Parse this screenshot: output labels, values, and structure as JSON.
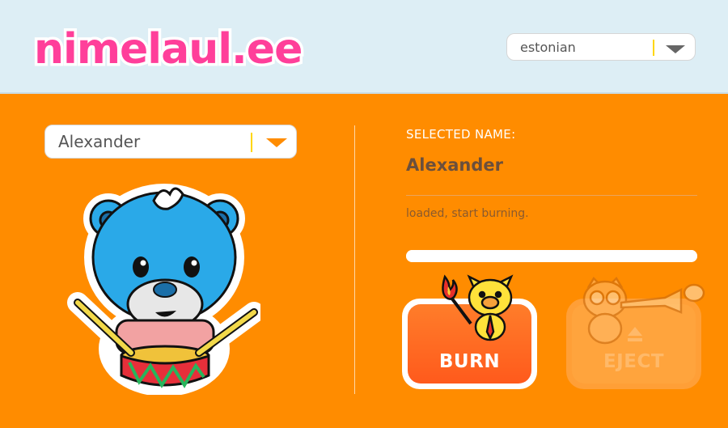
{
  "header": {
    "logo_text": "nimelaul.ee",
    "language_select": {
      "value": "estonian"
    }
  },
  "name_select": {
    "value": "Alexander"
  },
  "panel": {
    "selected_title": "SELECTED NAME:",
    "selected_name": "Alexander",
    "status": "loaded, start burning.",
    "progress": 1.0
  },
  "buttons": {
    "burn_label": "BURN",
    "eject_label": "EJECT"
  },
  "colors": {
    "background": "#ff8c00",
    "header": "#ddeef5",
    "logo": "#ff3f9a",
    "burn": "#ff6a22",
    "accent_divider": "#ffd600"
  },
  "icons": {
    "dropdown": "chevron-down-icon",
    "mascot": "bear-drummer-mascot",
    "burn_art": "pig-with-torch-illustration",
    "eject_art": "owl-with-trumpet-illustration",
    "eject_symbol": "eject-icon"
  }
}
